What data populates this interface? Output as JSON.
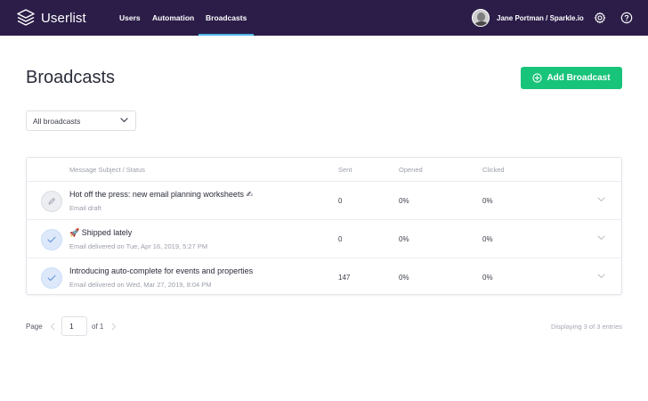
{
  "app": {
    "name": "Userlist",
    "brand_color": "#2b1d48",
    "accent_color": "#18c37a",
    "active_tab_color": "#4fb5e6"
  },
  "nav": {
    "items": [
      {
        "label": "Users",
        "active": false
      },
      {
        "label": "Automation",
        "active": false
      },
      {
        "label": "Broadcasts",
        "active": true
      }
    ]
  },
  "user": {
    "name": "Jane Portman / Sparkle.io",
    "icons": [
      "settings-gear-icon",
      "help-question-icon"
    ]
  },
  "page": {
    "title": "Broadcasts",
    "add_button_label": "Add Broadcast",
    "filter_value": "All broadcasts"
  },
  "table": {
    "columns": [
      "Message Subject / Status",
      "Sent",
      "Opened",
      "Clicked"
    ],
    "rows": [
      {
        "icon": "pencil-icon",
        "state": "draft",
        "subject": "Hot off the press: new email planning worksheets ✍",
        "status": "Email draft",
        "sent": "0",
        "opened": "0%",
        "clicked": "0%"
      },
      {
        "icon": "check-icon",
        "state": "sent",
        "subject": "🚀 Shipped lately",
        "status": "Email delivered on Tue, Apr 16, 2019, 5:27 PM",
        "sent": "0",
        "opened": "0%",
        "clicked": "0%"
      },
      {
        "icon": "check-icon",
        "state": "sent",
        "subject": "Introducing auto-complete for events and properties",
        "status": "Email delivered on Wed, Mar 27, 2019, 8:04 PM",
        "sent": "147",
        "opened": "0%",
        "clicked": "0%"
      }
    ]
  },
  "pagination": {
    "page_label": "Page",
    "current_page": "1",
    "of_label": "of 1",
    "entries_text": "Displaying 3 of 3 entries"
  }
}
